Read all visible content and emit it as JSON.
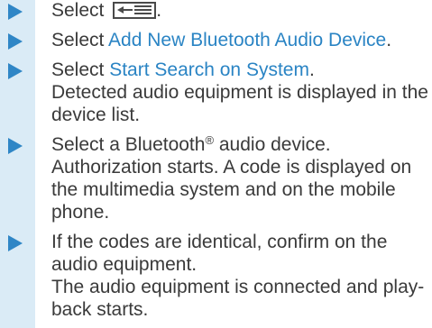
{
  "steps": [
    {
      "text": "Select",
      "icon": "list-menu-icon",
      "suffix": "."
    },
    {
      "prefix": "Select ",
      "link": "Add New Bluetooth Audio Device",
      "suffix": "."
    },
    {
      "prefix": "Select ",
      "link": "Start Search on System",
      "suffix": ".",
      "result_lines": [
        "Detected audio equipment is displayed in the",
        "device list."
      ]
    },
    {
      "prefix": "Select a Bluetooth",
      "sup": "®",
      "suffix": " audio device.",
      "result_lines": [
        "Authorization starts. A code is displayed on",
        "the multimedia system and on the mobile",
        "phone."
      ]
    },
    {
      "lines": [
        "If the codes are identical, confirm on the",
        "audio equipment."
      ],
      "result_lines": [
        "The audio equipment is connected and play-",
        "back starts."
      ]
    }
  ],
  "colors": {
    "arrow": "#2f86c6",
    "link": "#2a84c4",
    "band": "#daebf6",
    "text": "#3a3a3a"
  }
}
